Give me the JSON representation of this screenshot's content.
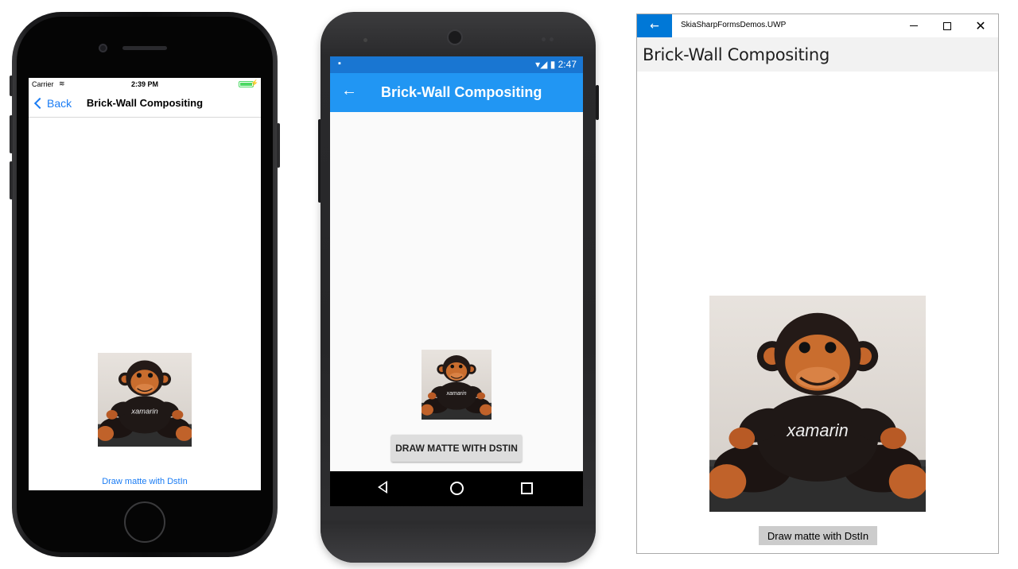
{
  "ios": {
    "carrier": "Carrier",
    "wifi_icon": "≋",
    "time": "2:39 PM",
    "back_label": "Back",
    "title": "Brick-Wall Compositing",
    "button_label": "Draw matte with DstIn",
    "battery_level": 1.0,
    "bolt": "⚡"
  },
  "android": {
    "status_left_icon": "▪",
    "status_right": "▾◢ ▮ 2:47",
    "back_icon": "←",
    "title": "Brick-Wall Compositing",
    "button_label": "DRAW MATTE WITH DSTIN",
    "toolbar_color": "#2196f3",
    "statusbar_color": "#1976d2"
  },
  "uwp": {
    "back_icon": "←",
    "app_name": "SkiaSharpFormsDemos.UWP",
    "close_icon": "✕",
    "page_title": "Brick-Wall Compositing",
    "button_label": "Draw matte with DstIn",
    "accent_color": "#0078d7"
  },
  "shirt_text": "xamarin"
}
